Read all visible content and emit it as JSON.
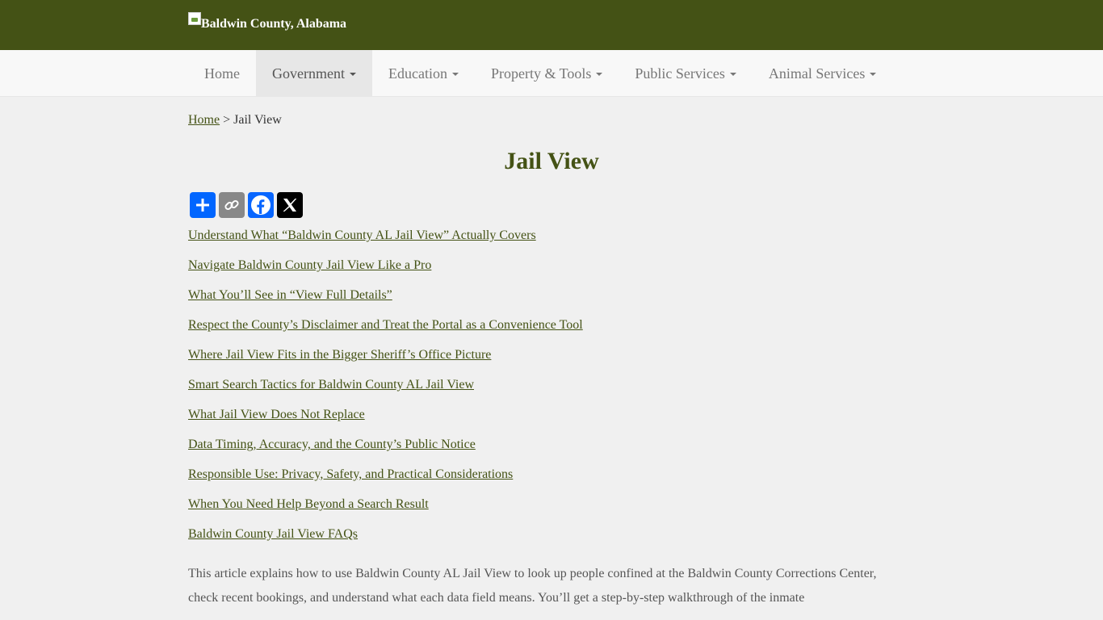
{
  "header": {
    "logo_alt": "Baldwin County, Alabama",
    "brand_color": "#445215"
  },
  "nav": {
    "items": [
      {
        "label": "Home",
        "dropdown": false
      },
      {
        "label": "Government",
        "dropdown": true,
        "active": true
      },
      {
        "label": "Education",
        "dropdown": true
      },
      {
        "label": "Property & Tools",
        "dropdown": true
      },
      {
        "label": "Public Services",
        "dropdown": true
      },
      {
        "label": "Animal Services",
        "dropdown": true
      }
    ]
  },
  "breadcrumb": {
    "home": "Home",
    "separator": ">",
    "current": "Jail View"
  },
  "page": {
    "title": "Jail View"
  },
  "share": {
    "icons": [
      "share-icon",
      "copy-link-icon",
      "facebook-icon",
      "x-icon"
    ]
  },
  "toc": [
    "Understand What “Baldwin County AL Jail View” Actually Covers",
    "Navigate Baldwin County Jail View Like a Pro",
    "What You’ll See in “View Full Details”",
    "Respect the County’s Disclaimer and Treat the Portal as a Convenience Tool",
    "Where Jail View Fits in the Bigger Sheriff’s Office Picture",
    "Smart Search Tactics for Baldwin County AL Jail View",
    "What Jail View Does Not Replace",
    "Data Timing, Accuracy, and the County’s Public Notice",
    "Responsible Use: Privacy, Safety, and Practical Considerations",
    "When You Need Help Beyond a Search Result",
    "Baldwin County Jail View FAQs"
  ],
  "intro": "This article explains how to use Baldwin County AL Jail View to look up people confined at the Baldwin County Corrections Center, check recent bookings, and understand what each data field means. You’ll get a step-by-step walkthrough of the inmate"
}
